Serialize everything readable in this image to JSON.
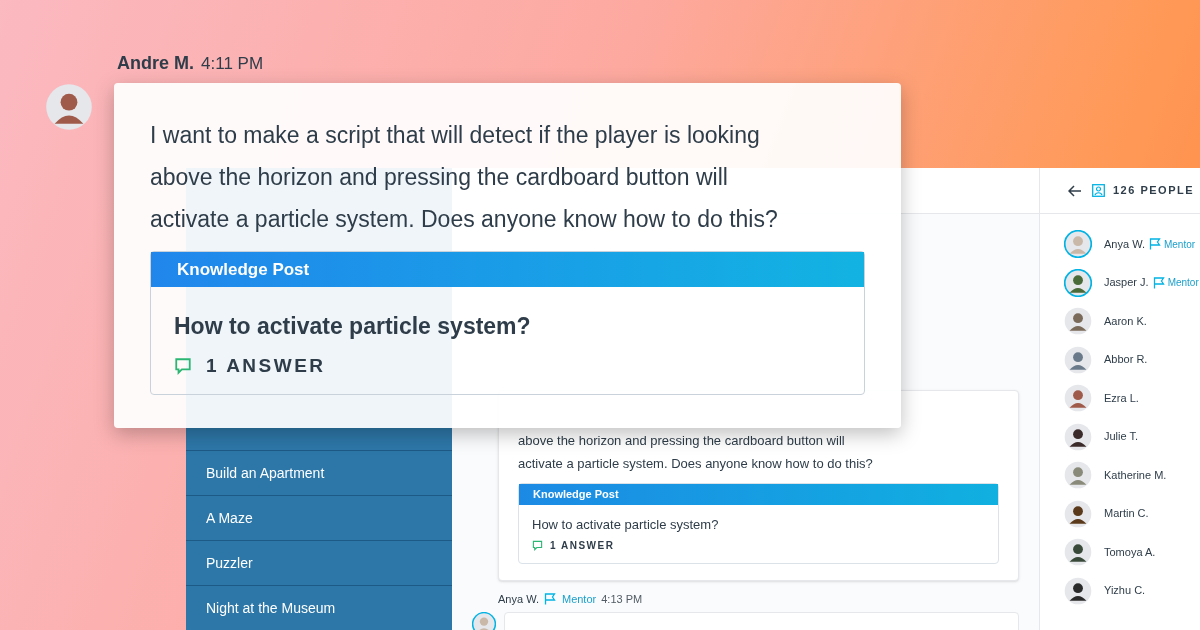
{
  "overlay_post": {
    "author": "Andre M.",
    "time": "4:11 PM",
    "message": "I want to make a script that will detect if the player is looking above the horizon and pressing the cardboard button will activate a particle system. Does anyone know how to do this?",
    "knowledge_post": {
      "label": "Knowledge Post",
      "title": "How to activate particle system?",
      "answers": "1 ANSWER"
    }
  },
  "sidebar": {
    "items": [
      {
        "label": "Build an Apartment"
      },
      {
        "label": "A Maze"
      },
      {
        "label": "Puzzler"
      },
      {
        "label": "Night at the Museum"
      }
    ]
  },
  "chat": {
    "message": {
      "text": "above the horizon and pressing the cardboard button will activate a particle system. Does anyone know how to do this?",
      "knowledge_post": {
        "label": "Knowledge Post",
        "title": "How to activate particle system?",
        "answers": "1 ANSWER"
      }
    },
    "next_message": {
      "author": "Anya W.",
      "badge": "Mentor",
      "time": "4:13 PM"
    }
  },
  "people_panel": {
    "count": "126 PEOPLE",
    "people": [
      {
        "name": "Anya W.",
        "mentor": true,
        "badge": "Mentor"
      },
      {
        "name": "Jasper J.",
        "mentor": true,
        "badge": "Mentor"
      },
      {
        "name": "Aaron K.",
        "mentor": false
      },
      {
        "name": "Abbor R.",
        "mentor": false
      },
      {
        "name": "Ezra L.",
        "mentor": false
      },
      {
        "name": "Julie T.",
        "mentor": false
      },
      {
        "name": "Katherine M.",
        "mentor": false
      },
      {
        "name": "Martin C.",
        "mentor": false
      },
      {
        "name": "Tomoya A.",
        "mentor": false
      },
      {
        "name": "Yizhu C.",
        "mentor": false
      }
    ]
  }
}
